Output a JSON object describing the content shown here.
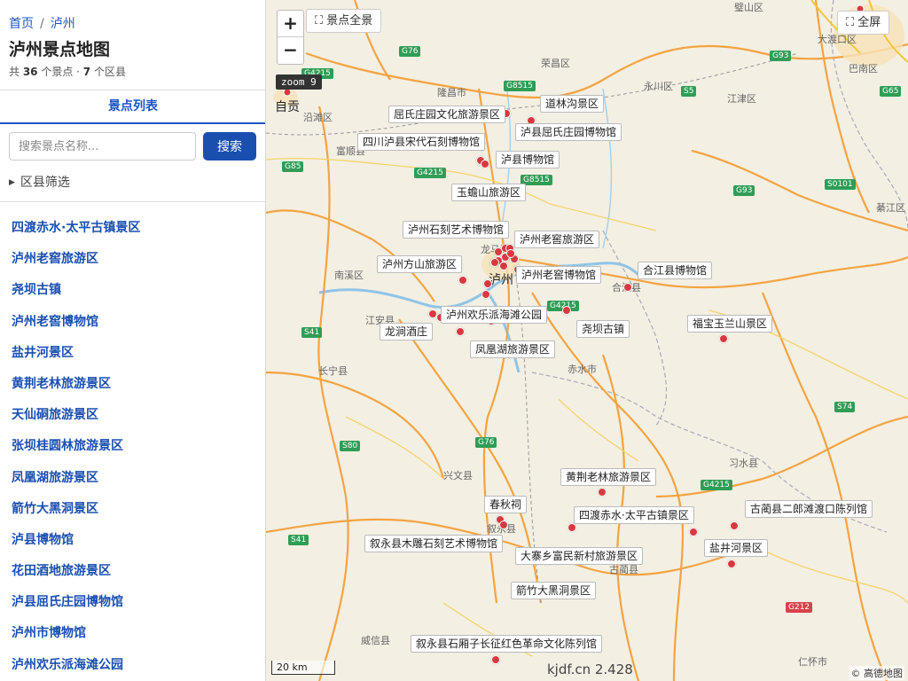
{
  "breadcrumb": {
    "home": "首页",
    "separator": "/",
    "current": "泸州"
  },
  "title": "泸州景点地图",
  "summary": {
    "prefix": "共 ",
    "spot_count": "36",
    "mid": " 个景点 · ",
    "district_count": "7",
    "suffix": " 个区县"
  },
  "tab": "景点列表",
  "search": {
    "placeholder": "搜索景点名称...",
    "button": "搜索"
  },
  "filter": {
    "icon": "triangle-right-icon",
    "label": "区县筛选"
  },
  "spots": [
    "四渡赤水·太平古镇景区",
    "泸州老窖旅游区",
    "尧坝古镇",
    "泸州老窖博物馆",
    "盐井河景区",
    "黄荆老林旅游景区",
    "天仙硐旅游景区",
    "张坝桂圆林旅游景区",
    "凤凰湖旅游景区",
    "箭竹大黑洞景区",
    "泸县博物馆",
    "花田酒地旅游景区",
    "泸县屈氏庄园博物馆",
    "泸州市博物馆",
    "泸州欢乐派海滩公园"
  ],
  "map": {
    "zoom_in": "+",
    "zoom_out": "−",
    "overview": "⛶ 景点全景",
    "fullscreen": "⛶ 全屏",
    "zoom_level": "zoom 9",
    "scale": "20 km",
    "watermark": "kjdf.cn 2.428",
    "attribution": "© 高德地图",
    "marker_color": "#d8393f",
    "labels": [
      "屈氏庄园文化旅游景区",
      "道林沟景区",
      "泸县屈氏庄园博物馆",
      "四川泸县宋代石刻博物馆",
      "泸县博物馆",
      "玉蟾山旅游区",
      "泸州石刻艺术博物馆",
      "泸州老窖旅游区",
      "泸州方山旅游区",
      "泸州老窖博物馆",
      "合江县博物馆",
      "泸州欢乐派海滩公园",
      "龙涧酒庄",
      "尧坝古镇",
      "福宝玉兰山景区",
      "凤凰湖旅游景区",
      "黄荆老林旅游景区",
      "春秋祠",
      "四渡赤水·太平古镇景区",
      "古蔺县二郎滩渡口陈列馆",
      "叙永县木雕石刻艺术博物馆",
      "大寨乡富民新村旅游景区",
      "盐井河景区",
      "箭竹大黑洞景区",
      "叙永县石厢子长征红色革命文化陈列馆"
    ],
    "places": [
      "自贡",
      "沿滩区",
      "隆昌市",
      "荣昌区",
      "永川区",
      "江津区",
      "巴南区",
      "大渡口区",
      "富顺县",
      "南溪区",
      "江安县",
      "长宁县",
      "泸州",
      "合江县",
      "赤水市",
      "兴文县",
      "叙永县",
      "古蔺县",
      "习水县",
      "威信县",
      "仁怀市",
      "綦江区",
      "璧山区",
      "龙马潭"
    ],
    "shields": [
      "G76",
      "G4215",
      "G8515",
      "G85",
      "G93",
      "S5",
      "S0101",
      "G65",
      "S41",
      "S80",
      "S74",
      "G212"
    ]
  }
}
